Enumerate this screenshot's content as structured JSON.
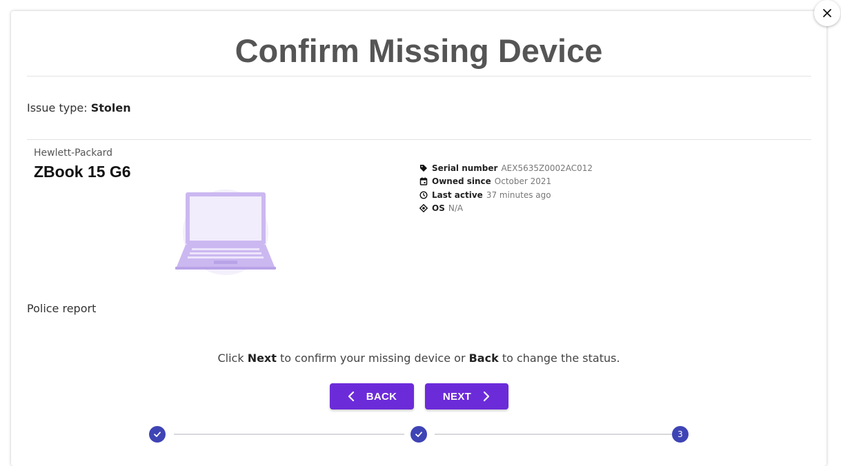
{
  "modal": {
    "title": "Confirm Missing Device",
    "close_icon": "close-icon"
  },
  "issue": {
    "label": "Issue type:",
    "value": "Stolen"
  },
  "device": {
    "manufacturer": "Hewlett-Packard",
    "model": "ZBook 15 G6",
    "image_icon": "laptop-illustration",
    "specs": [
      {
        "icon": "tag-icon",
        "label": "Serial number",
        "value": "AEX5635Z0002AC012"
      },
      {
        "icon": "calendar-icon",
        "label": "Owned since",
        "value": "October 2021"
      },
      {
        "icon": "clock-icon",
        "label": "Last active",
        "value": "37 minutes ago"
      },
      {
        "icon": "os-icon",
        "label": "OS",
        "value": "N/A"
      }
    ]
  },
  "police_report": {
    "label": "Police report"
  },
  "instruction": {
    "part1": "Click ",
    "next_word": "Next",
    "part2": " to confirm your missing device or ",
    "back_word": "Back",
    "part3": " to change the status."
  },
  "buttons": {
    "back_label": "BACK",
    "next_label": "NEXT"
  },
  "stepper": {
    "steps": [
      {
        "state": "completed",
        "label": ""
      },
      {
        "state": "completed",
        "label": ""
      },
      {
        "state": "active",
        "label": "3"
      }
    ]
  },
  "colors": {
    "primary": "#6c2bd9",
    "stepper": "#3f44b5",
    "laptop": "#cbb8f0"
  }
}
